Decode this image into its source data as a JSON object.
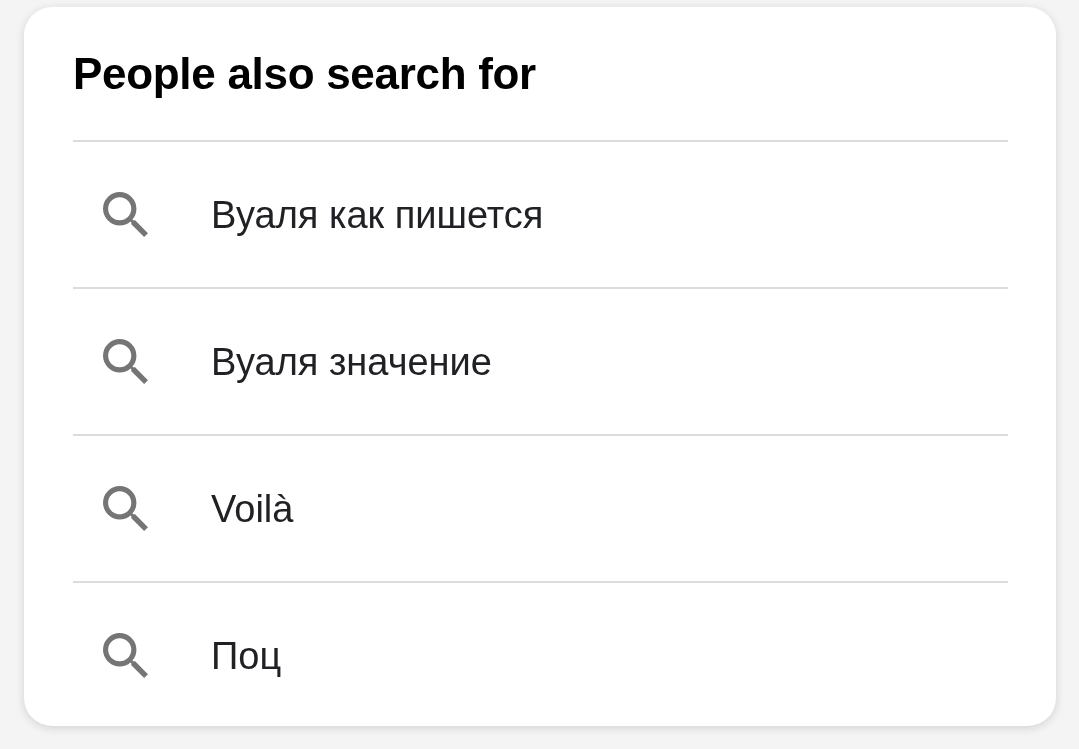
{
  "heading": "People also search for",
  "suggestions": [
    {
      "text": "Вуаля как пишется"
    },
    {
      "text": "Вуаля значение"
    },
    {
      "text": "Voilà"
    },
    {
      "text": "Поц"
    }
  ]
}
